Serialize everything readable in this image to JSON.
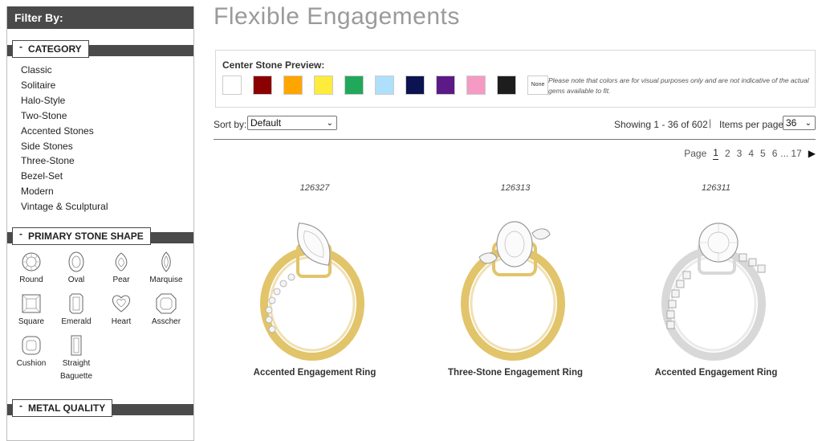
{
  "sidebar": {
    "filter_title": "Filter By:",
    "category": {
      "title": "CATEGORY",
      "items": [
        "Classic",
        "Solitaire",
        "Halo-Style",
        "Two-Stone",
        "Accented Stones",
        "Side Stones",
        "Three-Stone",
        "Bezel-Set",
        "Modern",
        "Vintage & Sculptural"
      ]
    },
    "shape": {
      "title": "PRIMARY STONE SHAPE",
      "items": [
        "Round",
        "Oval",
        "Pear",
        "Marquise",
        "Square",
        "Emerald",
        "Heart",
        "Asscher",
        "Cushion",
        "Straight Baguette"
      ]
    },
    "metal": {
      "title": "METAL QUALITY"
    },
    "collapse_symbol": "-"
  },
  "main": {
    "title": "Flexible Engagements",
    "preview": {
      "title": "Center Stone Preview:",
      "colors": [
        "#ffffff",
        "#8b0000",
        "#ffa500",
        "#ffeb3b",
        "#22a85a",
        "#aee0fb",
        "#0b1450",
        "#5c1a87",
        "#f59ac3",
        "#1d1d1d"
      ],
      "none_label": "None",
      "note": "Please note that colors are for visual purposes only and are not indicative of the actual gems available to fit."
    },
    "toolbar": {
      "sort_label": "Sort by:",
      "sort_value": "Default",
      "showing": "Showing 1 - 36 of 602",
      "separator": "|",
      "ipp_label": "Items per page:",
      "ipp_value": "36"
    },
    "pager": {
      "label": "Page",
      "pages": [
        "1",
        "2",
        "3",
        "4",
        "5",
        "6"
      ],
      "current": "1",
      "ellipsis": "...",
      "last": "17",
      "next_icon": "▶"
    },
    "products": [
      {
        "sku": "126327",
        "name": "Accented Engagement Ring",
        "metal_color": "#e2c46a",
        "stone_shape": "marquise"
      },
      {
        "sku": "126313",
        "name": "Three-Stone Engagement Ring",
        "metal_color": "#e2c46a",
        "stone_shape": "oval"
      },
      {
        "sku": "126311",
        "name": "Accented Engagement Ring",
        "metal_color": "#d8d8d8",
        "stone_shape": "round"
      }
    ]
  }
}
